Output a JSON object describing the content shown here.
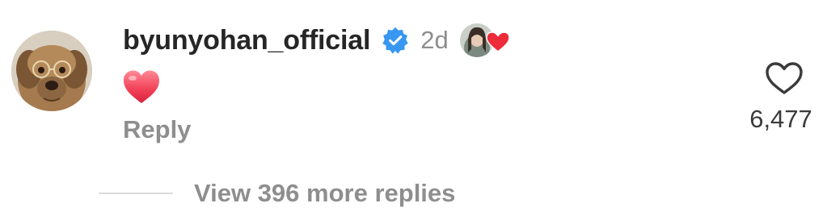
{
  "comment": {
    "username": "byunyohan_official",
    "verified_icon": "verified-badge-icon",
    "time_ago": "2d",
    "liked_by_creator_icon": "creator-liked-heart-icon",
    "text_emoji": "red-heart-emoji",
    "reply_label": "Reply",
    "like_icon": "heart-outline-icon",
    "like_count": "6,477",
    "view_replies_label": "View 396 more replies"
  },
  "colors": {
    "verified_blue": "#3897f0",
    "heart_red": "#ed4956",
    "muted_text": "#8e8e8e",
    "divider": "#dbdbdb"
  }
}
